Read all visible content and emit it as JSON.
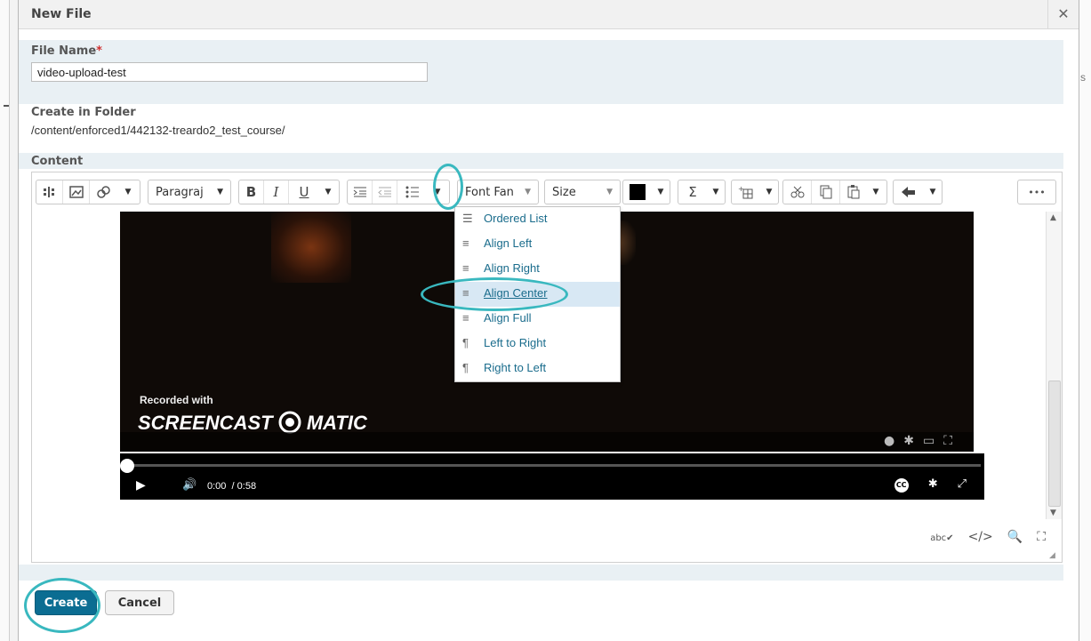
{
  "dialog": {
    "title": "New File",
    "close_glyph": "✕"
  },
  "fields": {
    "file_name_label": "File Name",
    "required_mark": "*",
    "file_name_value": "video-upload-test",
    "create_in_folder_label": "Create in Folder",
    "folder_path": "/content/enforced1/442132-treardo2_test_course/",
    "content_label": "Content"
  },
  "toolbar": {
    "paragraph_label": "Paragraj",
    "bold_label": "B",
    "italic_label": "I",
    "underline_label": "U",
    "font_family_label": "Font Fan",
    "size_label": "Size",
    "text_color": "#000000",
    "sigma_label": "Σ",
    "more_label": "•••"
  },
  "list_dropdown": {
    "items": [
      {
        "label": "Ordered List",
        "icon": "ordered-list-icon"
      },
      {
        "label": "Align Left",
        "icon": "align-left-icon"
      },
      {
        "label": "Align Right",
        "icon": "align-right-icon"
      },
      {
        "label": "Align Center",
        "icon": "align-center-icon"
      },
      {
        "label": "Align Full",
        "icon": "align-full-icon"
      },
      {
        "label": "Left to Right",
        "icon": "ltr-icon"
      },
      {
        "label": "Right to Left",
        "icon": "rtl-icon"
      }
    ],
    "highlighted_item": "Align Center"
  },
  "video_preview": {
    "recorded_with": "Recorded with",
    "logo_text": "SCREENCAST",
    "logo_suffix": "MATIC"
  },
  "video_player": {
    "current_time": "0:00",
    "duration": "/ 0:58",
    "progress": 0,
    "cc_label": "CC"
  },
  "buttons": {
    "create_label": "Create",
    "cancel_label": "Cancel"
  },
  "colors": {
    "primary": "#0b6d92",
    "highlight_ring": "#39b8bf",
    "link": "#1a6c8c",
    "band": "#e9f0f4"
  }
}
